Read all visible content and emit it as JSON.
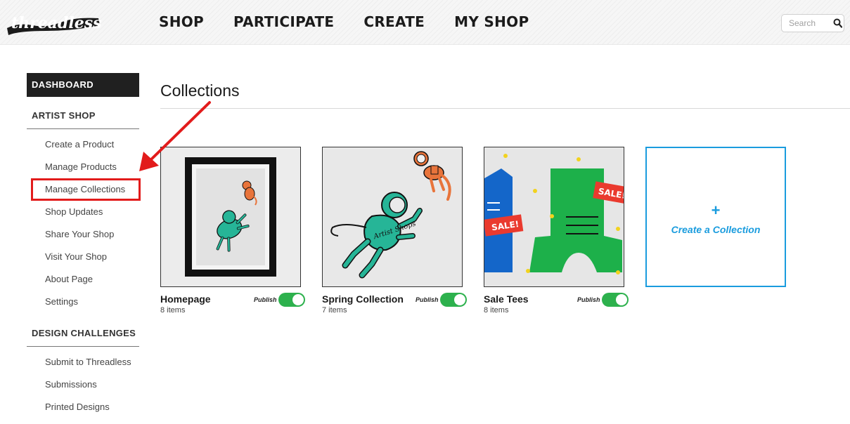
{
  "header": {
    "logo_text": "threadless",
    "nav": [
      "SHOP",
      "PARTICIPATE",
      "CREATE",
      "MY SHOP"
    ],
    "search": {
      "placeholder": "Search",
      "icon": "search-icon"
    }
  },
  "sidebar": {
    "dashboard": "DASHBOARD",
    "artist_shop": {
      "heading": "ARTIST SHOP",
      "items": [
        "Create a Product",
        "Manage Products",
        "Manage Collections",
        "Shop Updates",
        "Share Your Shop",
        "Visit Your Shop",
        "About Page",
        "Settings"
      ],
      "active": "Manage Collections"
    },
    "design_challenges": {
      "heading": "DESIGN CHALLENGES",
      "items": [
        "Submit to Threadless",
        "Submissions",
        "Printed Designs"
      ]
    }
  },
  "main": {
    "title": "Collections",
    "collections": [
      {
        "name": "Homepage",
        "count": "8 items",
        "publish_label": "Publish",
        "published": true
      },
      {
        "name": "Spring Collection",
        "count": "7 items",
        "publish_label": "Publish",
        "published": true
      },
      {
        "name": "Sale Tees",
        "count": "8 items",
        "publish_label": "Publish",
        "published": true
      }
    ],
    "create": {
      "plus": "+",
      "label": "Create a Collection"
    }
  },
  "colors": {
    "accent_blue": "#1a9cde",
    "toggle_green": "#2db14d",
    "highlight_red": "#e21b1b",
    "dashboard_bg": "#202020"
  },
  "artwork_text": {
    "badge_1": "SALE!",
    "badge_2": "SALE!",
    "shirt_text": "Artist Shops"
  }
}
